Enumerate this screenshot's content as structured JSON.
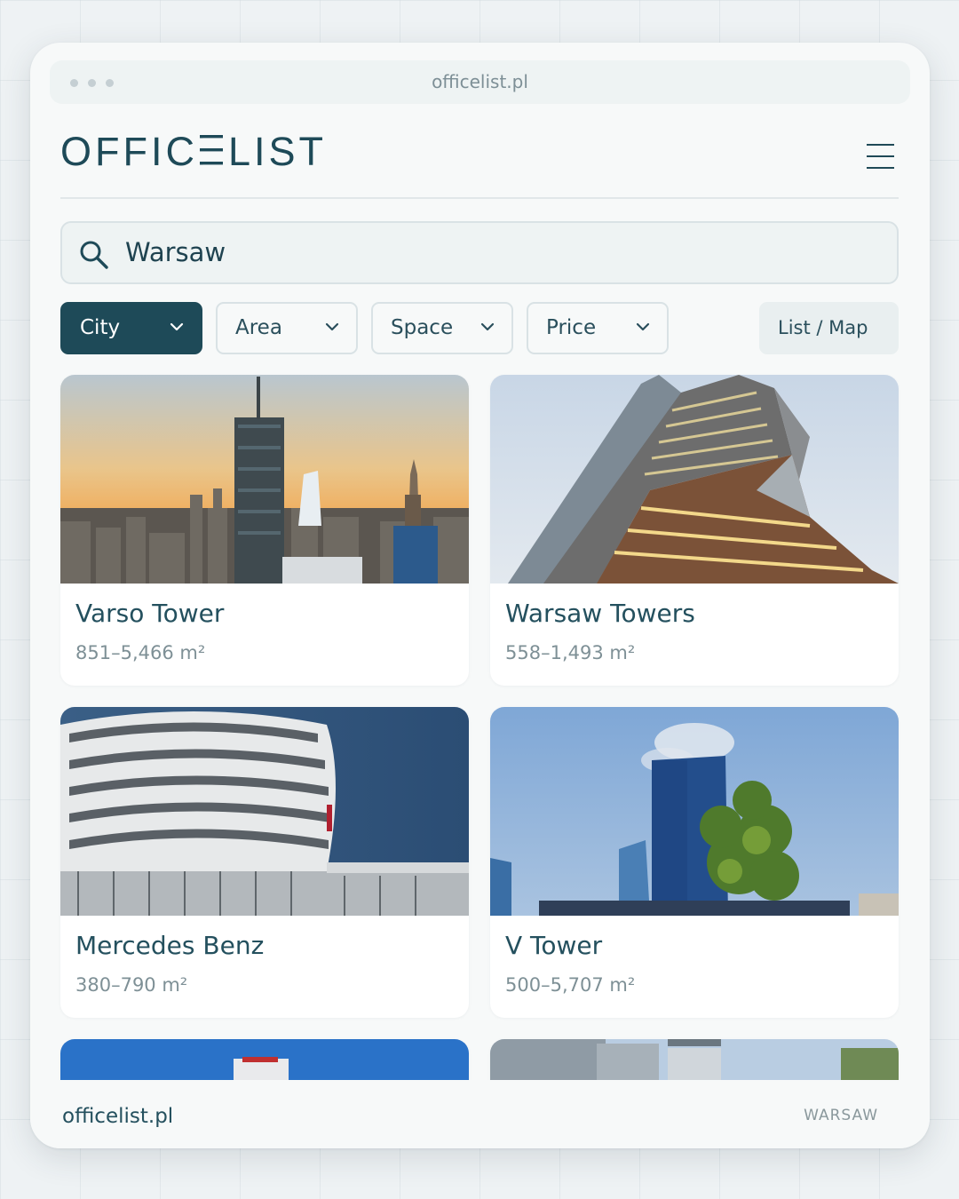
{
  "browser": {
    "url": "officelist.pl"
  },
  "brand": {
    "name": "OFFICELIST",
    "left": "OFFIC",
    "right": "LIST",
    "color": "#1e4a58"
  },
  "search": {
    "value": "Warsaw",
    "placeholder": ""
  },
  "filters": [
    {
      "label": "City",
      "active": true
    },
    {
      "label": "Area",
      "active": false
    },
    {
      "label": "Space",
      "active": false
    },
    {
      "label": "Price",
      "active": false
    }
  ],
  "view_toggle": {
    "label": "List / Map"
  },
  "listings": [
    {
      "title": "Varso Tower",
      "area": "851–5,466 m²",
      "photo": "sunset-skyline-tower"
    },
    {
      "title": "Warsaw Towers",
      "area": "558–1,493 m²",
      "photo": "curved-glass-tower"
    },
    {
      "title": "Mercedes Benz",
      "area": "380–790 m²",
      "photo": "round-white-office"
    },
    {
      "title": "V Tower",
      "area": "500–5,707 m²",
      "photo": "blue-glass-tower-with-tree"
    },
    {
      "title": "",
      "area": "",
      "photo": "tower-against-blue-sky"
    },
    {
      "title": "",
      "area": "",
      "photo": "business-district"
    }
  ],
  "footer": {
    "url": "officelist.pl",
    "city": "WARSAW"
  },
  "colors": {
    "accent": "#1e4a58",
    "background": "#eef2f4",
    "card": "#ffffff",
    "muted_text": "#7e9096"
  }
}
